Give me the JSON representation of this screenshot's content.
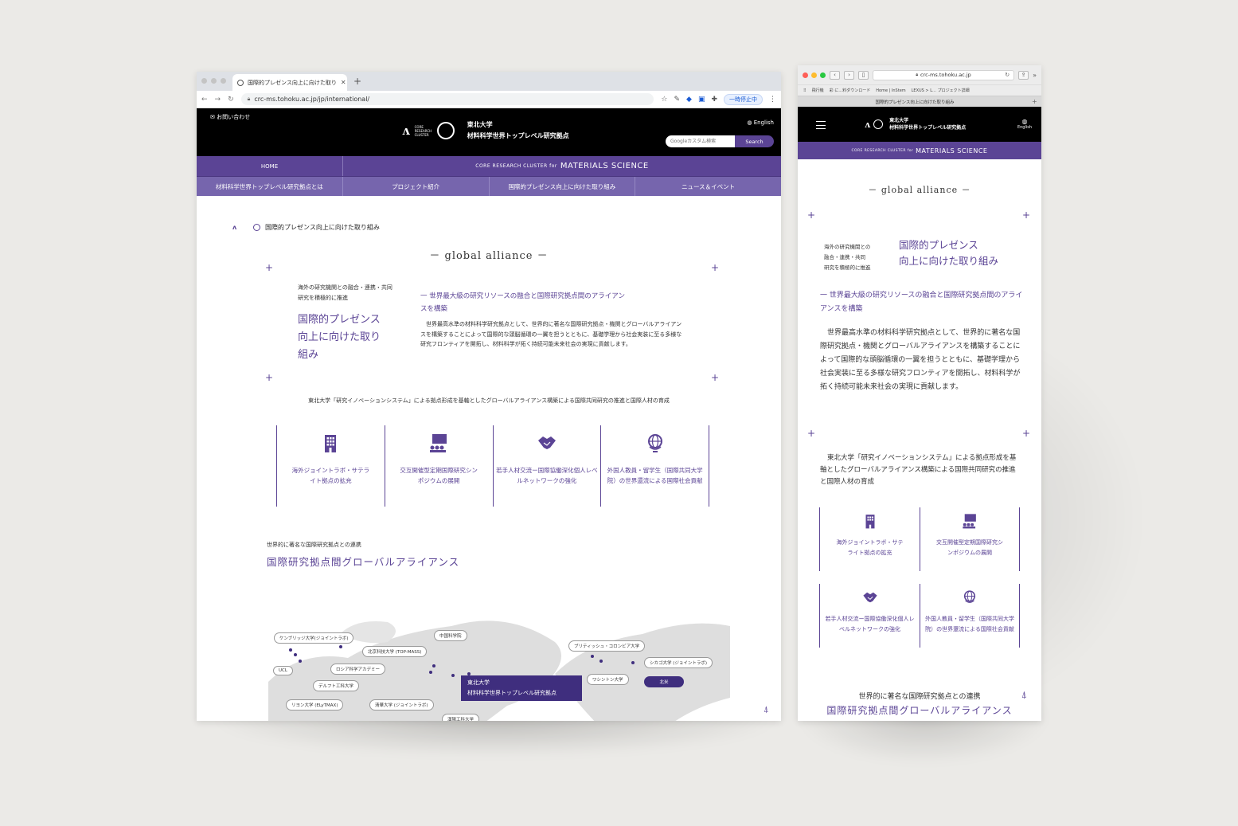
{
  "chrome": {
    "tab_title": "国際的プレゼンス向上に向けた取り",
    "url": "crc-ms.tohoku.ac.jp/jp/international/",
    "pause_label": "一時停止中"
  },
  "safari": {
    "url": "crc-ms.tohoku.ac.jp",
    "bookmarks": [
      "飛行機",
      "彩 に…料ダウンロード",
      "Home | InStem",
      "LEXUS > L… プロジェクト詳細"
    ],
    "tab_title": "国際的プレゼンス向上に向けた取り組み"
  },
  "header": {
    "contact": "お問い合わせ",
    "logo_word": "CORE RESEARCH CLUSTER",
    "univ": "東北大学",
    "center": "材料科学世界トップレベル研究拠点",
    "lang": "English",
    "search_placeholder": "Googleカスタム検索",
    "search_button": "Search"
  },
  "nav": {
    "home": "HOME",
    "crc_prefix": "CORE RESEARCH CLUSTER for",
    "crc_main": "MATERIALS SCIENCE",
    "items": [
      "材料科学世界トップレベル研究拠点とは",
      "プロジェクト紹介",
      "国際的プレゼンス向上に向けた取り組み",
      "ニュース＆イベント"
    ]
  },
  "page": {
    "breadcrumb": "国際的プレゼンス向上に向けた取り組み",
    "section_title": "－ global alliance －",
    "lead_small": "海外の研究機関との融合・連携・共同研究を積極的に推進",
    "lead_big": "国際的プレゼンス向上に向けた取り組み",
    "sub_heading": "一 世界最大級の研究リソースの融合と国際研究拠点間のアライアンスを構築",
    "body": "世界最高水準の材料科学研究拠点として、世界的に著名な国際研究拠点・機関とグローバルアライアンスを構築することによって国際的な頭脳循環の一翼を担うとともに、基礎学理から社会実装に至る多様な研究フロンティアを開拓し、材料科学が拓く持続可能未来社会の実現に貢献します。",
    "innovation_line": "東北大学「研究イノベーションシステム」による拠点形成を基軸としたグローバルアライアンス構築による国際共同研究の推進と国際人材の育成",
    "cards": [
      {
        "icon": "building-icon",
        "label": "海外ジョイントラボ・サテライト拠点の拡充"
      },
      {
        "icon": "symposium-icon",
        "label": "交互開催型定期国際研究シンポジウムの展開"
      },
      {
        "icon": "handshake-icon",
        "label": "若手人材交流ー国際協働深化個人レベルネットワークの強化"
      },
      {
        "icon": "globe-icon",
        "label": "外国人教員・留学生（国際共同大学院）の世界還流による国際社会貢献"
      }
    ],
    "alliance_small": "世界的に著名な国際研究拠点との連携",
    "alliance_big": "国際研究拠点間グローバルアライアンス",
    "map_labels": [
      "ケンブリッジ大学(ジョイントラボ)",
      "UCL",
      "北京科技大学 (TOP-MASS)",
      "中国科学院",
      "ロシア科学アカデミー",
      "デルフト工科大学",
      "リヨン大学 (ELyTMAX)",
      "清華大学 (ジョイントラボ)",
      "漢陽工科大学",
      "ブリティッシュ・コロンビア大学",
      "シカゴ大学 (ジョイントラボ)",
      "ワシントン大学",
      "北米"
    ],
    "hq_univ": "東北大学",
    "hq_center": "材料科学世界トップレベル研究拠点"
  },
  "mobile": {
    "lead_small_lines": [
      "海外の研究機関との",
      "融合・連携・共同",
      "研究を積極的に推進"
    ],
    "lead_big_lines": [
      "国際的プレゼンス",
      "向上に向けた取り組み"
    ],
    "sub_heading": "一 世界最大級の研究リソースの融合と国際研究拠点間のアライアンスを構築",
    "lang": "English"
  },
  "colors": {
    "brand": "#5b4495",
    "brand_dark": "#3f2e7e",
    "header_bg": "#000000"
  }
}
